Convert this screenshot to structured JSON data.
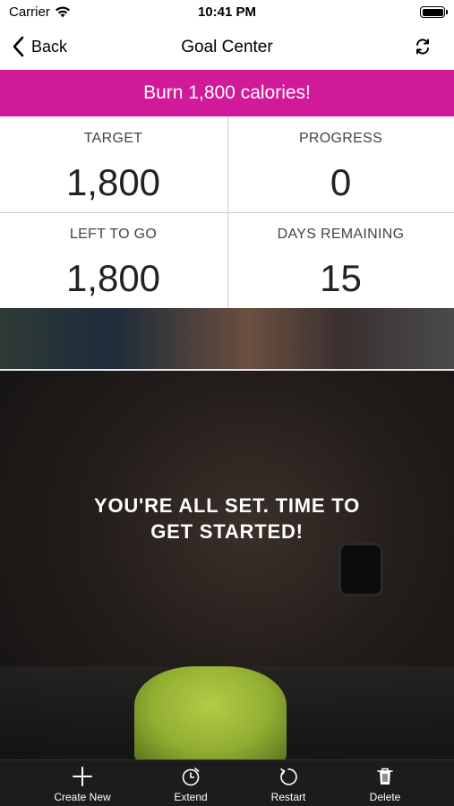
{
  "status_bar": {
    "carrier": "Carrier",
    "time": "10:41 PM"
  },
  "nav": {
    "back_label": "Back",
    "title": "Goal Center"
  },
  "goal": {
    "banner_text": "Burn 1,800 calories!",
    "banner_color": "#d11a9a"
  },
  "stats": [
    {
      "label": "TARGET",
      "value": "1,800"
    },
    {
      "label": "PROGRESS",
      "value": "0"
    },
    {
      "label": "LEFT TO GO",
      "value": "1,800"
    },
    {
      "label": "DAYS REMAINING",
      "value": "15"
    }
  ],
  "hero": {
    "message_line1": "YOU'RE ALL SET. TIME TO",
    "message_line2": "GET STARTED!"
  },
  "tab_bar": {
    "items": [
      {
        "label": "Create New",
        "icon": "plus-icon"
      },
      {
        "label": "Extend",
        "icon": "clock-icon"
      },
      {
        "label": "Restart",
        "icon": "restart-icon"
      },
      {
        "label": "Delete",
        "icon": "trash-icon"
      }
    ]
  }
}
